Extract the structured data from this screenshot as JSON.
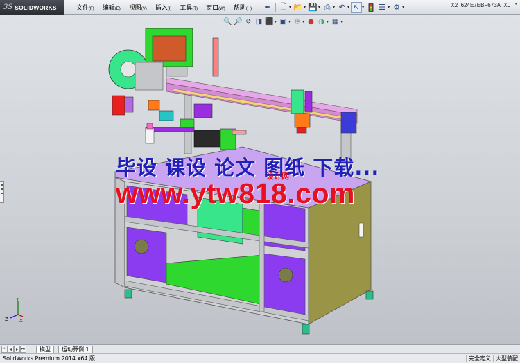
{
  "app": {
    "logo_prefix": "3S",
    "logo_text": "SOLIDWORKS",
    "document_title": "_X2_624E7EBF673A_X0_ *"
  },
  "menu": [
    {
      "label": "文件",
      "accel": "(F)"
    },
    {
      "label": "编辑",
      "accel": "(E)"
    },
    {
      "label": "视图",
      "accel": "(V)"
    },
    {
      "label": "插入",
      "accel": "(I)"
    },
    {
      "label": "工具",
      "accel": "(T)"
    },
    {
      "label": "窗口",
      "accel": "(W)"
    },
    {
      "label": "帮助",
      "accel": "(H)"
    }
  ],
  "toolbar_icons": [
    "pin-icon",
    "new-document-icon",
    "open-folder-icon",
    "save-icon",
    "print-icon",
    "undo-icon",
    "select-arrow-icon",
    "rebuild-traffic-light-icon",
    "file-properties-icon",
    "options-icon"
  ],
  "hud_icons": [
    "zoom-to-fit-icon",
    "zoom-area-icon",
    "previous-view-icon",
    "section-view-icon",
    "view-orientation-icon",
    "display-style-icon",
    "hide-show-items-icon",
    "edit-appearance-icon",
    "apply-scene-icon",
    "view-settings-icon"
  ],
  "watermark": {
    "line1": "毕设 课设 论文 图纸 下载...",
    "line2": "www.ytw818.com",
    "small": "设计网"
  },
  "triad": {
    "y": "Y",
    "x": "X",
    "z": "Z"
  },
  "tabs": [
    {
      "label": "模型"
    },
    {
      "label": "运动算例 1"
    }
  ],
  "status": {
    "left": "SolidWorks Premium 2014 x64 版",
    "right_items": [
      "完全定义",
      "大型装配"
    ]
  },
  "colors": {
    "watermark_blue": "#2020b8",
    "watermark_red": "#e81020",
    "frame_gray": "#c4c6c9",
    "panel_purple": "#8c3cf0",
    "panel_olive": "#9a9446",
    "base_green": "#2fd82f",
    "top_plate_lilac": "#c9a4f0"
  }
}
